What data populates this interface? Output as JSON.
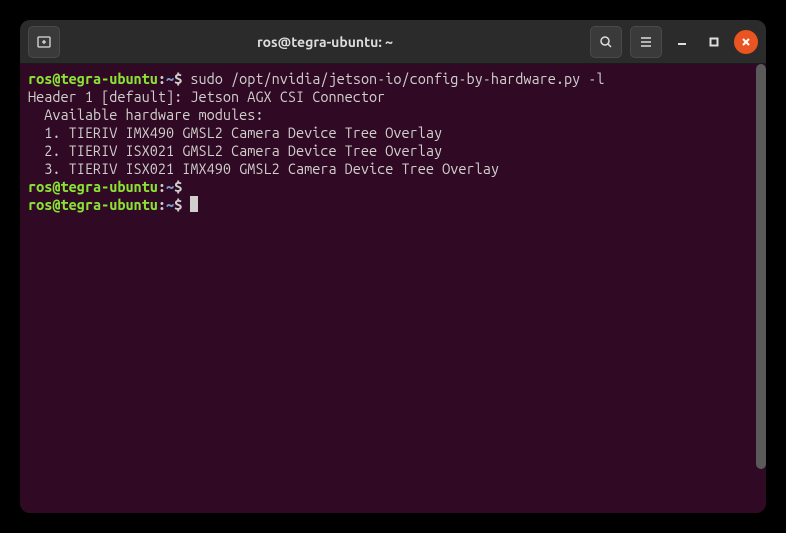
{
  "titlebar": {
    "title": "ros@tegra-ubuntu: ~"
  },
  "terminal": {
    "lines": [
      {
        "type": "prompt_command",
        "user": "ros@tegra-ubuntu",
        "path": "~",
        "command": "sudo /opt/nvidia/jetson-io/config-by-hardware.py -l"
      },
      {
        "type": "output",
        "text": "Header 1 [default]: Jetson AGX CSI Connector"
      },
      {
        "type": "output",
        "text": "  Available hardware modules:"
      },
      {
        "type": "output",
        "text": "  1. TIERIV IMX490 GMSL2 Camera Device Tree Overlay"
      },
      {
        "type": "output",
        "text": "  2. TIERIV ISX021 GMSL2 Camera Device Tree Overlay"
      },
      {
        "type": "output",
        "text": "  3. TIERIV ISX021 IMX490 GMSL2 Camera Device Tree Overlay"
      },
      {
        "type": "prompt_empty",
        "user": "ros@tegra-ubuntu",
        "path": "~"
      },
      {
        "type": "prompt_cursor",
        "user": "ros@tegra-ubuntu",
        "path": "~"
      }
    ]
  },
  "icons": {
    "new_tab": "new-tab-icon",
    "search": "search-icon",
    "menu": "menu-icon",
    "minimize": "minimize-icon",
    "maximize": "maximize-icon",
    "close": "close-icon"
  }
}
